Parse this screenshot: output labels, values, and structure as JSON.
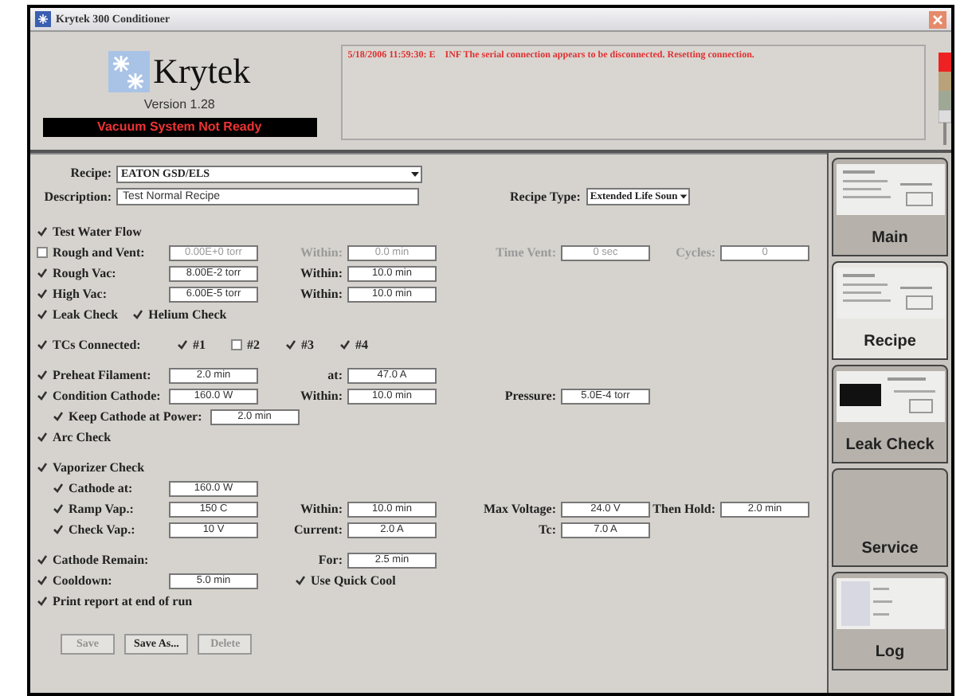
{
  "window": {
    "title": "Krytek 300 Conditioner"
  },
  "header": {
    "logo": "Krytek",
    "version": "Version 1.28",
    "status": "Vacuum System Not Ready",
    "message": "5/18/2006 11:59:30: E    INF The serial connection appears to be disconnected. Resetting connection."
  },
  "recipe": {
    "label": "Recipe:",
    "value": "EATON GSD/ELS"
  },
  "description": {
    "label": "Description:",
    "value": "Test Normal Recipe"
  },
  "recipe_type": {
    "label": "Recipe Type:",
    "value": "Extended Life Soun"
  },
  "sections": [
    {
      "rows": [
        {
          "label": "Test Water Flow",
          "checked": true,
          "indented": false,
          "cells": []
        },
        {
          "label": "Rough and Vent:",
          "checked": false,
          "indented": false,
          "cells": [
            {
              "kind": "field",
              "value": "0.00E+0 torr",
              "disabled": true
            },
            {
              "kind": "field",
              "label": "Within:",
              "value": "0.0 min",
              "disabled": true
            },
            {
              "kind": "field",
              "label": "Time Vent:",
              "value": "0 sec",
              "disabled": true
            },
            {
              "kind": "field",
              "label": "Cycles:",
              "value": "0",
              "disabled": true
            }
          ]
        },
        {
          "label": "Rough Vac:",
          "checked": true,
          "indented": false,
          "cells": [
            {
              "kind": "field",
              "value": "8.00E-2 torr",
              "disabled": false
            },
            {
              "kind": "field",
              "label": "Within:",
              "value": "10.0 min",
              "disabled": false
            }
          ]
        },
        {
          "label": "High Vac:",
          "checked": true,
          "indented": false,
          "cells": [
            {
              "kind": "field",
              "value": "6.00E-5 torr",
              "disabled": false
            },
            {
              "kind": "field",
              "label": "Within:",
              "value": "10.0 min",
              "disabled": false
            }
          ]
        },
        {
          "label": "Leak Check",
          "checked": true,
          "indented": false,
          "extra": {
            "label": "Helium Check",
            "checked": true
          },
          "cells": []
        }
      ]
    },
    {
      "rows": [
        {
          "label": "TCs Connected:",
          "checked": true,
          "indented": false,
          "options": [
            {
              "label": "#1",
              "checked": true
            },
            {
              "label": "#2",
              "checked": false
            },
            {
              "label": "#3",
              "checked": true
            },
            {
              "label": "#4",
              "checked": true
            }
          ],
          "cells": []
        }
      ]
    },
    {
      "rows": [
        {
          "label": "Preheat Filament:",
          "checked": true,
          "indented": false,
          "cells": [
            {
              "kind": "field",
              "value": "2.0 min",
              "disabled": false
            },
            {
              "kind": "field",
              "label": "at:",
              "value": "47.0 A",
              "disabled": false
            }
          ]
        },
        {
          "label": "Condition Cathode:",
          "checked": true,
          "indented": false,
          "cells": [
            {
              "kind": "field",
              "value": "160.0 W",
              "disabled": false
            },
            {
              "kind": "field",
              "label": "Within:",
              "value": "10.0 min",
              "disabled": false
            },
            {
              "kind": "field",
              "label": "Pressure:",
              "value": "5.0E-4 torr",
              "disabled": false
            }
          ]
        },
        {
          "label": "Keep Cathode at Power:",
          "checked": true,
          "indented": true,
          "cells": [
            {
              "kind": "field",
              "value": "2.0 min",
              "disabled": false
            }
          ]
        },
        {
          "label": "Arc Check",
          "checked": true,
          "indented": false,
          "cells": []
        }
      ]
    },
    {
      "rows": [
        {
          "label": "Vaporizer Check",
          "checked": true,
          "indented": false,
          "cells": []
        },
        {
          "label": "Cathode at:",
          "checked": true,
          "indented": true,
          "cells": [
            {
              "kind": "field",
              "value": "160.0 W",
              "disabled": false
            }
          ]
        },
        {
          "label": "Ramp Vap.:",
          "checked": true,
          "indented": true,
          "cells": [
            {
              "kind": "field",
              "value": "150 C",
              "disabled": false
            },
            {
              "kind": "field",
              "label": "Within:",
              "value": "10.0 min",
              "disabled": false
            },
            {
              "kind": "field",
              "label": "Max Voltage:",
              "value": "24.0 V",
              "disabled": false
            },
            {
              "kind": "field",
              "label": "Then Hold:",
              "value": "2.0 min",
              "disabled": false
            }
          ]
        },
        {
          "label": "Check Vap.:",
          "checked": true,
          "indented": true,
          "cells": [
            {
              "kind": "field",
              "value": "10 V",
              "disabled": false
            },
            {
              "kind": "field",
              "label": "Current:",
              "value": "2.0 A",
              "disabled": false
            },
            {
              "kind": "field",
              "label": "Tc:",
              "value": "7.0 A",
              "disabled": false
            }
          ]
        }
      ]
    },
    {
      "rows": [
        {
          "label": "Cathode Remain:",
          "checked": true,
          "indented": false,
          "cells": [
            null,
            {
              "kind": "field",
              "label": "For:",
              "value": "2.5 min",
              "disabled": false
            }
          ]
        },
        {
          "label": "Cooldown:",
          "checked": true,
          "indented": false,
          "cells": [
            {
              "kind": "field",
              "value": "5.0 min",
              "disabled": false
            },
            {
              "kind": "check",
              "label": "Use Quick Cool",
              "checked": true
            }
          ]
        },
        {
          "label": "Print report at end of run",
          "checked": true,
          "indented": false,
          "cells": []
        }
      ]
    }
  ],
  "buttons": [
    {
      "label": "Save",
      "disabled": true
    },
    {
      "label": "Save As...",
      "disabled": false
    },
    {
      "label": "Delete",
      "disabled": true
    }
  ],
  "tabs": [
    {
      "label": "Main",
      "selected": false,
      "kind": "preview"
    },
    {
      "label": "Recipe",
      "selected": true,
      "kind": "preview"
    },
    {
      "label": "Leak Check",
      "selected": false,
      "kind": "dark_preview"
    },
    {
      "label": "Service",
      "selected": false,
      "kind": "plain"
    },
    {
      "label": "Log",
      "selected": false,
      "kind": "list_preview"
    }
  ]
}
